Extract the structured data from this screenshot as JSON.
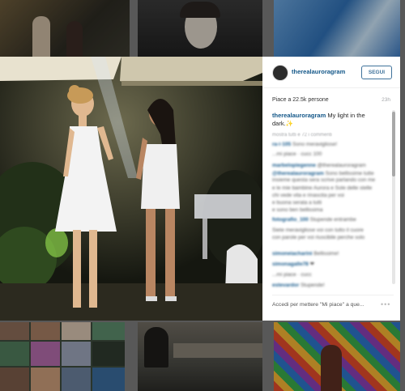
{
  "header": {
    "username": "therealauroragram",
    "follow_label": "SEGUI"
  },
  "post": {
    "likes": "Piace a 22.5k persone",
    "time": "23h",
    "caption_user": "therealauroragram",
    "caption_text": "My light in the dark.✨",
    "load_more": "mostra tutti e 72 i commenti",
    "add_like_prompt": "Accedi per mettere \"Mi piace\" a que...",
    "more_options": "•••"
  },
  "comments": [
    {
      "user": "ra·i·105",
      "text": "Sono meravigliose!"
    },
    {
      "user": "",
      "text": "...mi piace · cucc 100"
    },
    {
      "user": "marbelopiegenne",
      "text": "@therealauroragram"
    },
    {
      "user": "@therealauroragram",
      "text": "Sono bellissime tutte insieme questa sera scrive parlando con me"
    },
    {
      "user": "",
      "text": "e le mie bambine Aurora e Sole delle stelle"
    },
    {
      "user": "",
      "text": "chi vede vita e rinascita per voi"
    },
    {
      "user": "",
      "text": "e buona serata a tutti"
    },
    {
      "user": "",
      "text": "e sono ben bellissima"
    },
    {
      "user": "fotografio_100",
      "text": "Stupende entrambe"
    },
    {
      "user": "",
      "text": "Siete meravigliose voi con tutto il cuore"
    },
    {
      "user": "",
      "text": "con parole per voi riuscibile perche solo"
    },
    {
      "user": "simoneiacharini",
      "text": "Bellissime!"
    },
    {
      "user": "simonagalle78",
      "text": "❤"
    },
    {
      "user": "",
      "text": "...mi piace · cucc"
    },
    {
      "user": "estevardor",
      "text": "Stupende!"
    }
  ]
}
